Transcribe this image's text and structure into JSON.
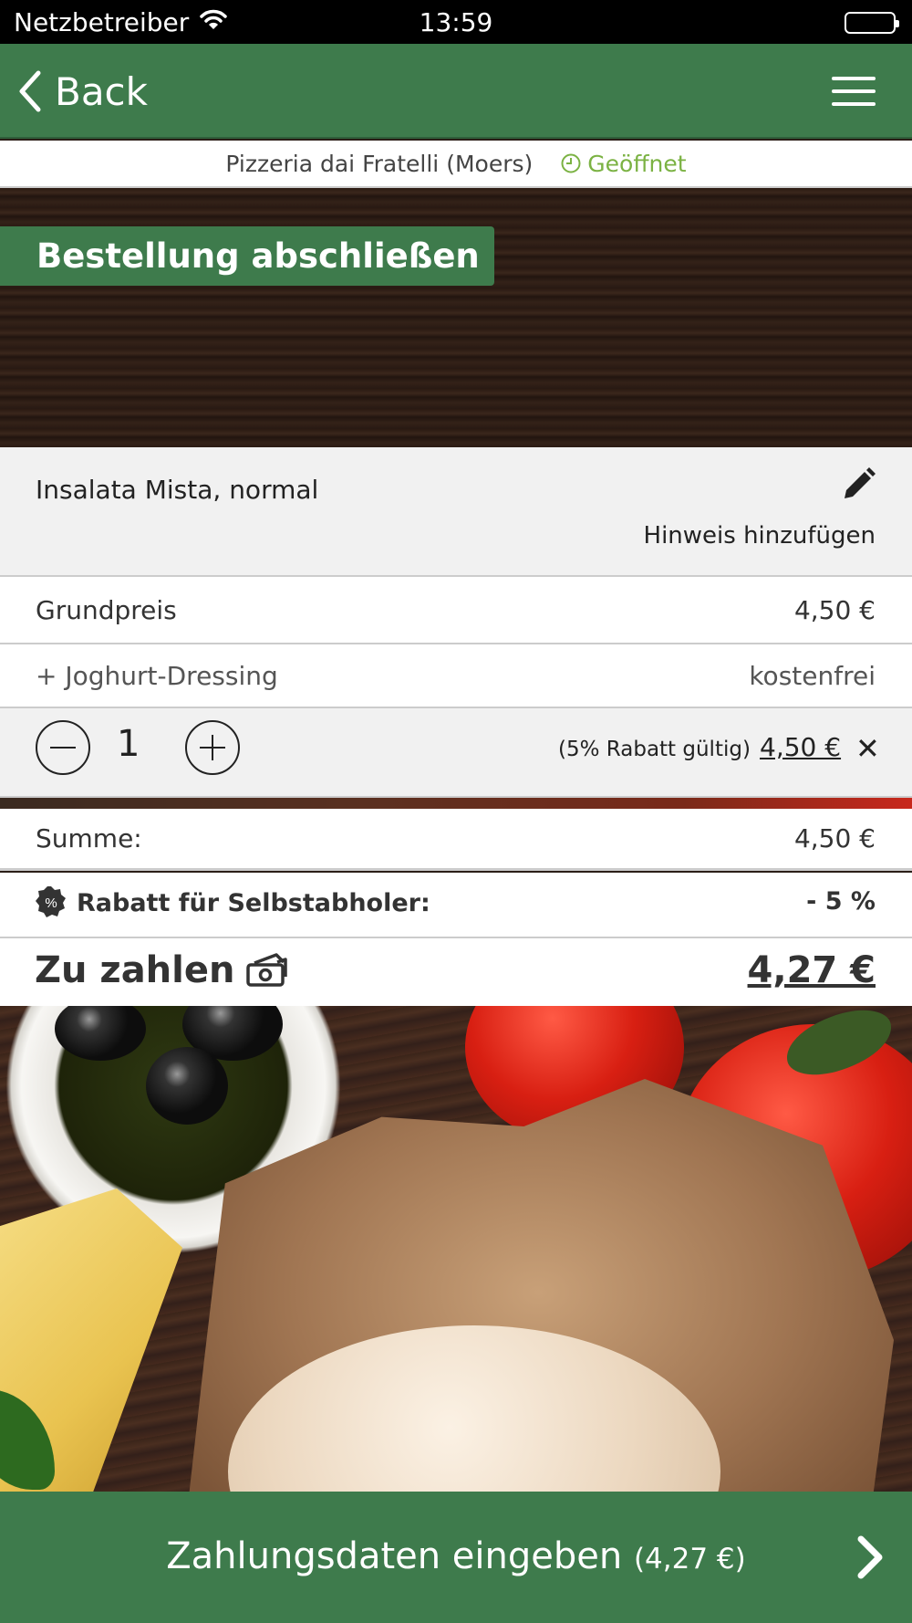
{
  "status_bar": {
    "carrier": "Netzbetreiber",
    "time": "13:59"
  },
  "nav": {
    "back_label": "Back",
    "menu_icon": "hamburger-icon"
  },
  "restaurant": {
    "name": "Pizzeria dai Fratelli (Moers)",
    "status": "Geöffnet",
    "status_color": "#7bb243"
  },
  "page": {
    "title": "Bestellung abschließen"
  },
  "order_item": {
    "name": "Insalata Mista, normal",
    "hint_label": "Hinweis hinzufügen"
  },
  "lines": [
    {
      "label": "Grundpreis",
      "value": "4,50 €"
    },
    {
      "label": "+ Joghurt-Dressing",
      "value": "kostenfrei"
    }
  ],
  "quantity": {
    "count": "1",
    "discount_note": "(5% Rabatt gültig)",
    "total": "4,50 €"
  },
  "summary": {
    "sum_label": "Summe:",
    "sum_value": "4,50 €",
    "rabatt_label": "Rabatt für Selbstabholer:",
    "rabatt_value": "- 5 %",
    "rabatt_badge": "%",
    "pay_label": "Zu zahlen",
    "pay_value": "4,27 €"
  },
  "footer": {
    "label": "Zahlungsdaten eingeben",
    "amount": "(4,27 €)"
  },
  "colors": {
    "brand_green": "#3e7b4c"
  }
}
